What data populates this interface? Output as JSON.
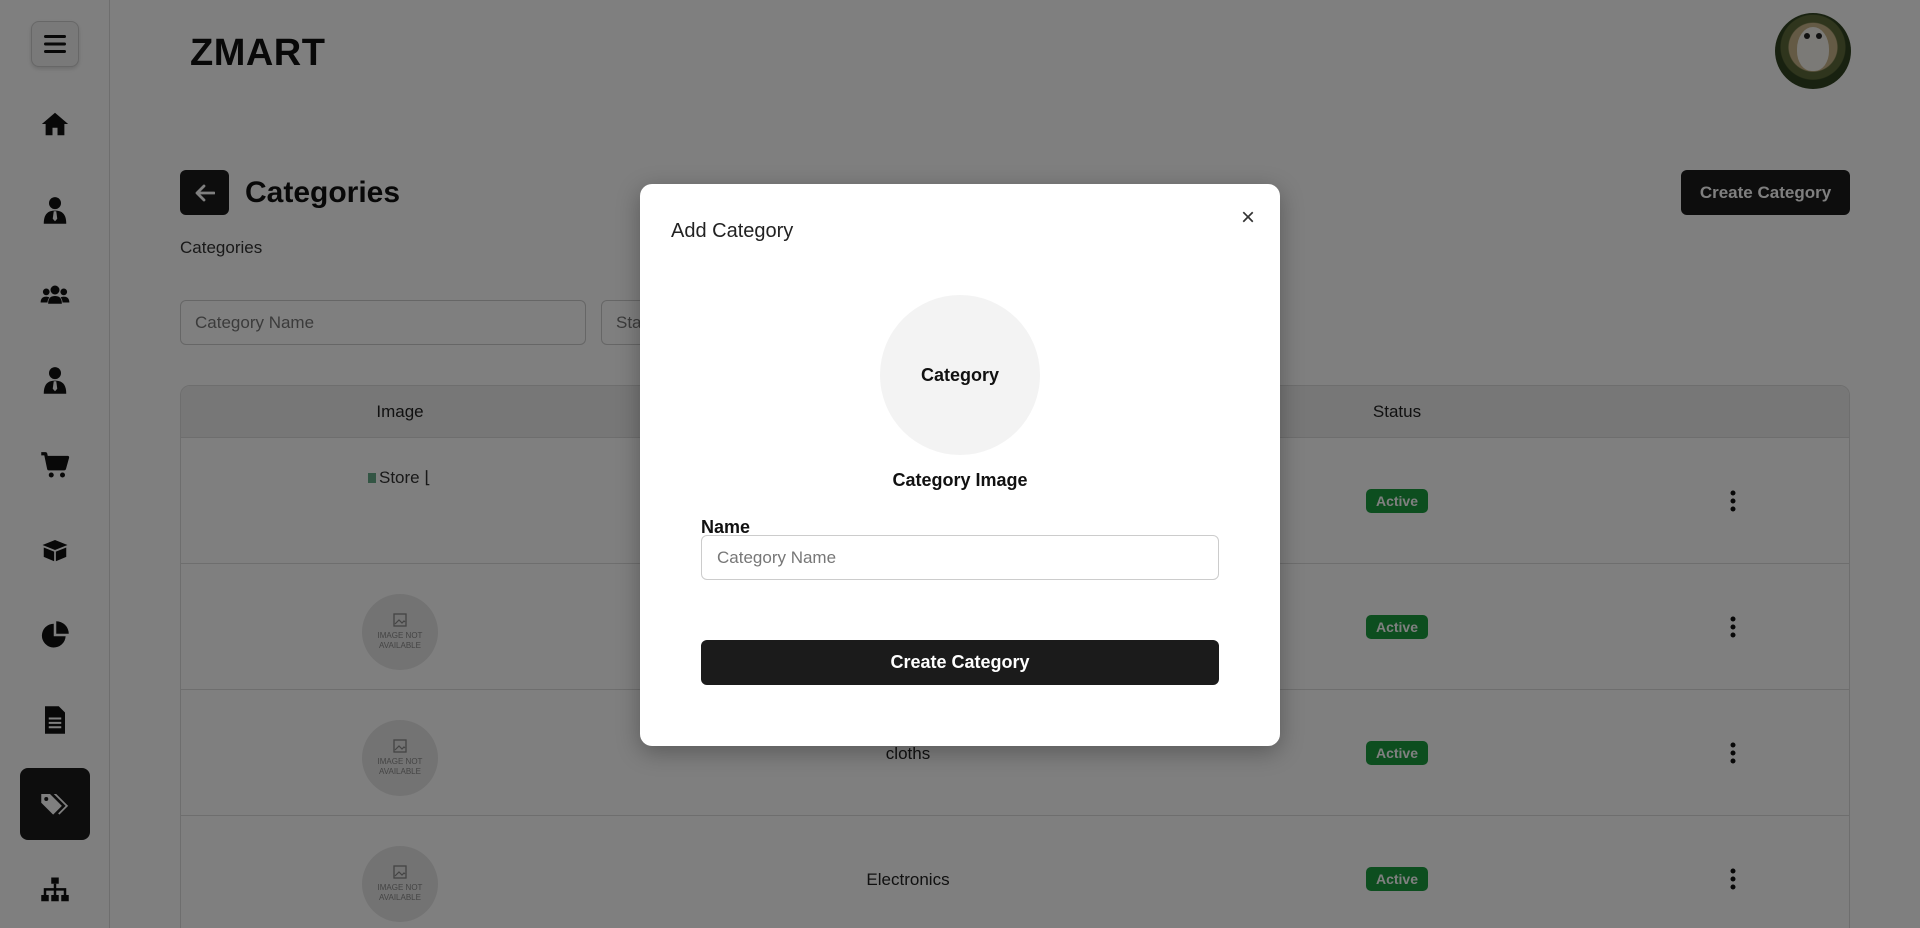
{
  "app": {
    "brand": "ZMART"
  },
  "sidebar": {
    "items": [
      {
        "name": "home-icon"
      },
      {
        "name": "user-tie-icon"
      },
      {
        "name": "users-icon"
      },
      {
        "name": "user-tie-icon"
      },
      {
        "name": "cart-icon"
      },
      {
        "name": "box-icon"
      },
      {
        "name": "pie-chart-icon"
      },
      {
        "name": "document-icon"
      },
      {
        "name": "tags-icon",
        "active": true
      },
      {
        "name": "sitemap-icon"
      }
    ]
  },
  "page": {
    "title": "Categories",
    "breadcrumb": "Categories",
    "create_button": "Create Category"
  },
  "filters": {
    "name_placeholder": "Category Name",
    "status_placeholder": "Sta"
  },
  "table": {
    "headers": [
      "Image",
      "Status"
    ],
    "image_not_available": "IMAGE NOT AVAILABLE",
    "rows": [
      {
        "image_alt": "Store ⌊",
        "name": "",
        "status": "Active"
      },
      {
        "image_alt": "",
        "name": "",
        "status": "Active"
      },
      {
        "image_alt": "",
        "name": "cloths",
        "status": "Active"
      },
      {
        "image_alt": "",
        "name": "Electronics",
        "status": "Active"
      }
    ]
  },
  "modal": {
    "title": "Add Category",
    "close_icon": "×",
    "image_placeholder": "Category",
    "image_caption": "Category Image",
    "name_label": "Name",
    "name_placeholder": "Category Name",
    "submit_label": "Create Category"
  },
  "colors": {
    "primary": "#1b1b1b",
    "active_badge": "#1a9c3e",
    "overlay": "rgba(0,0,0,0.5)"
  }
}
